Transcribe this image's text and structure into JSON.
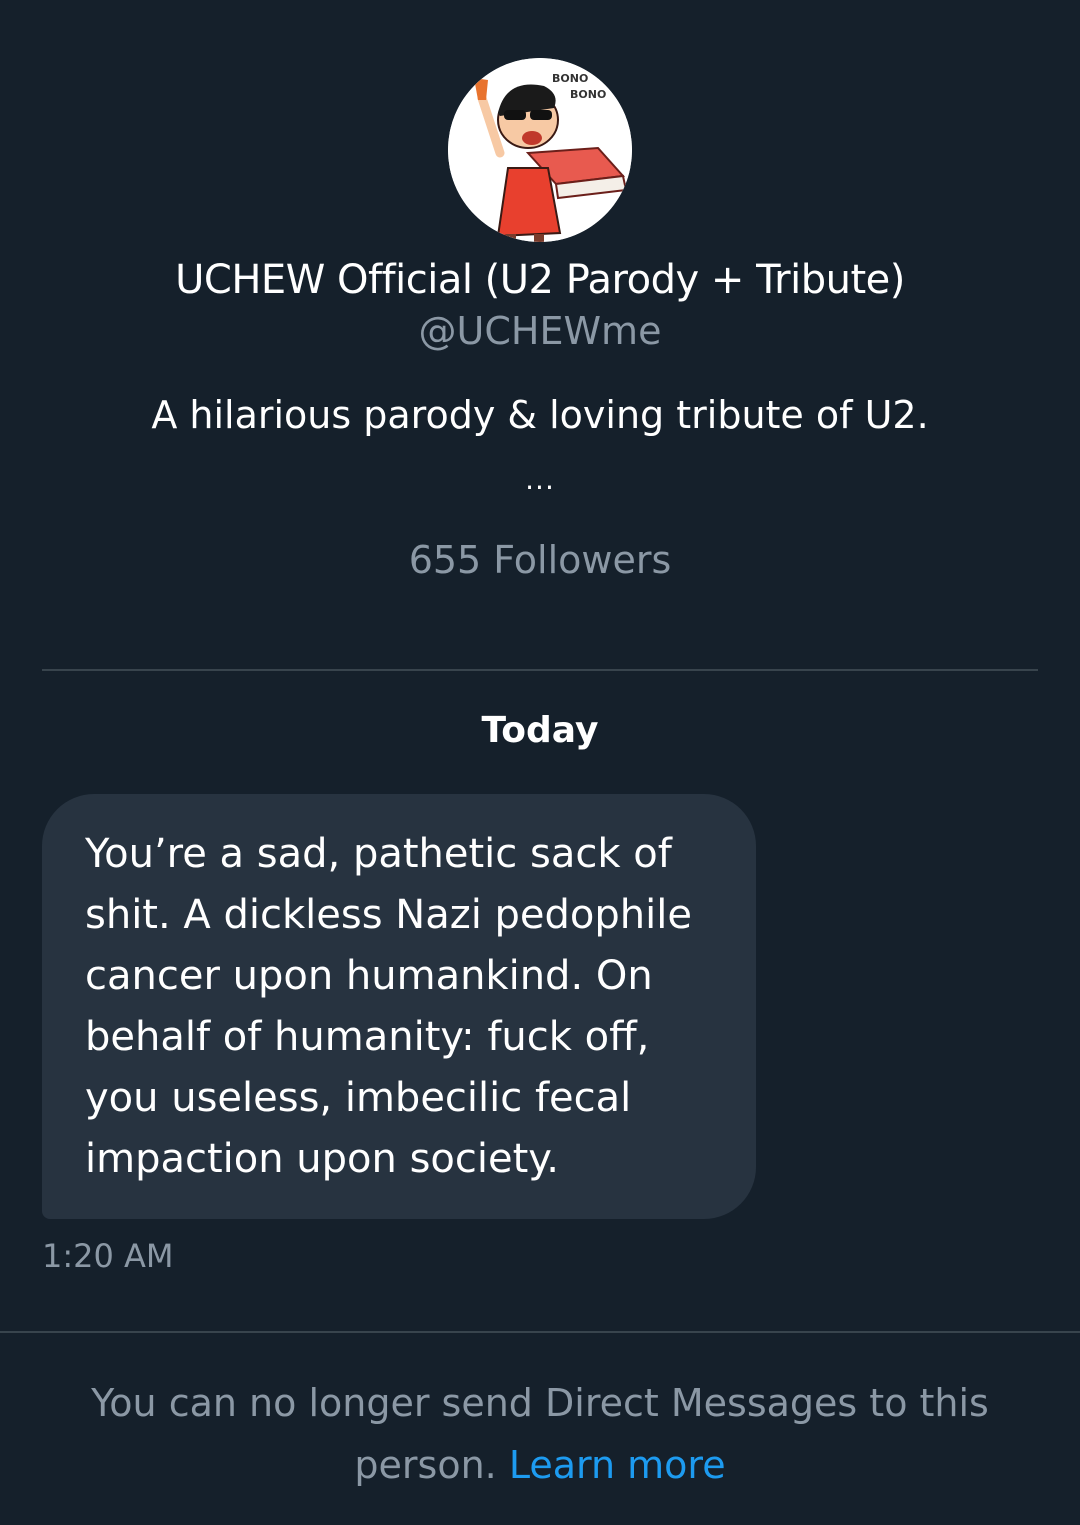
{
  "profile": {
    "name": "UCHEW Official (U2 Parody + Tribute)",
    "handle": "@UCHEWme",
    "bio": "A hilarious parody & loving tribute of U2.",
    "bio_more": "...",
    "followers": "655 Followers",
    "avatar_icon": "cartoon-avatar-icon",
    "avatar_text": [
      "BONO",
      "BONO"
    ]
  },
  "conversation": {
    "date_label": "Today",
    "messages": [
      {
        "lines": [
          "You’re a sad, pathetic sack of",
          "shit. A dickless Nazi pedophile",
          "cancer upon humankind. On",
          "behalf of humanity: fuck off,",
          "you useless, imbecilic fecal",
          "impaction upon society."
        ],
        "time": "1:20 AM"
      }
    ]
  },
  "footer": {
    "notice_prefix": "You can no longer send Direct Messages to this person.",
    "learn_more": "Learn more"
  },
  "colors": {
    "background": "#15202b",
    "bubble": "#273340",
    "secondary_text": "#8b98a5",
    "link": "#1d9bf0",
    "divider": "#38444d"
  }
}
